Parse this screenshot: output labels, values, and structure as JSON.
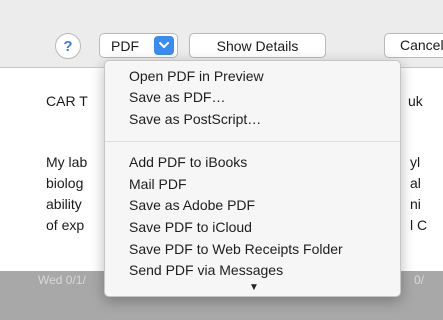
{
  "dialog": {
    "help_label": "?",
    "pdf_label": "PDF",
    "show_details_label": "Show Details",
    "cancel_label": "Cancel"
  },
  "document": {
    "heading_left": "CAR T",
    "heading_right": "uk",
    "lines_left": [
      "My lab",
      "biolog",
      "ability",
      "of exp"
    ],
    "lines_right": [
      "yl",
      "al",
      "ni",
      "l C"
    ],
    "footer_left": "Wed 0/1/",
    "footer_right": "0/"
  },
  "menu": {
    "group1": [
      "Open PDF in Preview",
      "Save as PDF…",
      "Save as PostScript…"
    ],
    "group2": [
      "Add PDF to iBooks",
      "Mail PDF",
      "Save as Adobe PDF",
      "Save PDF to iCloud",
      "Save PDF to Web Receipts Folder",
      "Send PDF via Messages"
    ],
    "more_arrow": "▼"
  },
  "colors": {
    "accent": "#3b8cf2",
    "menu_bg": "#f6f6f6",
    "dialog_bg": "#ececec"
  }
}
